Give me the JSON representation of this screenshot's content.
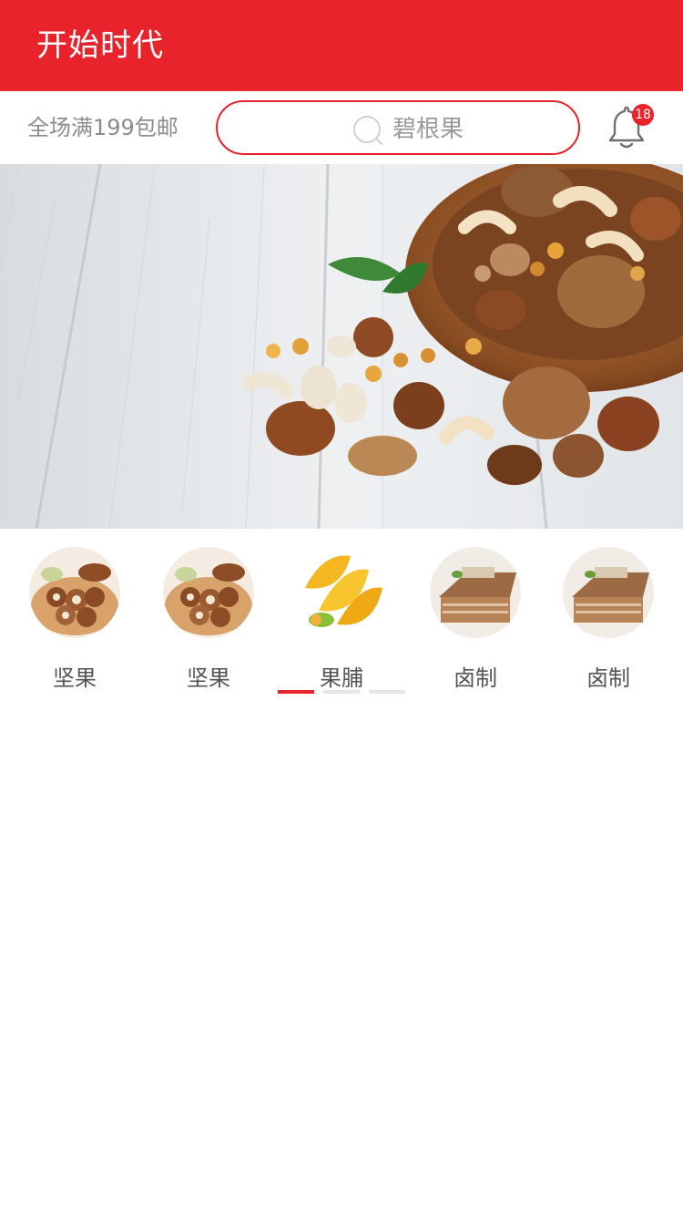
{
  "header": {
    "title": "开始时代"
  },
  "topbar": {
    "promo": "全场满199包邮",
    "search_placeholder": "碧根果",
    "notification_count": "18"
  },
  "categories": [
    {
      "label": "坚果",
      "icon": "nuts-bowl-image"
    },
    {
      "label": "坚果",
      "icon": "nuts-bowl-image"
    },
    {
      "label": "果脯",
      "icon": "dried-mango-image"
    },
    {
      "label": "卤制",
      "icon": "braised-tofu-image"
    },
    {
      "label": "卤制",
      "icon": "braised-tofu-image"
    }
  ],
  "pager": {
    "pages": 3,
    "active": 0
  },
  "colors": {
    "brand": "#e8232b",
    "muted_text": "#8c8c8c",
    "label_text": "#555555"
  }
}
